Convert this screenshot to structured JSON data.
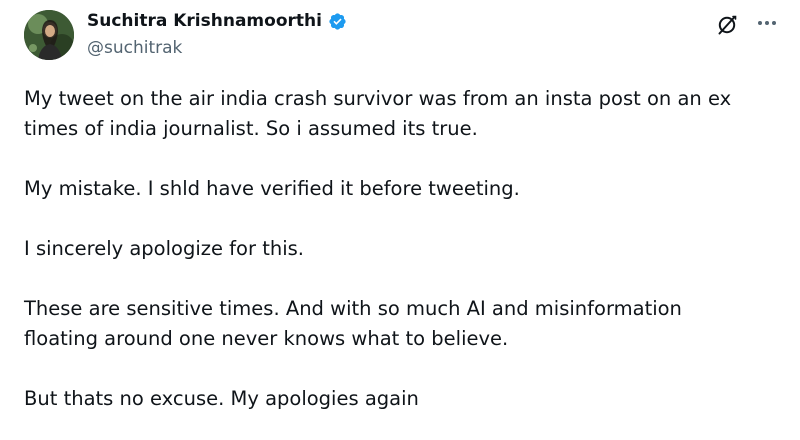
{
  "author": {
    "display_name": "Suchitra Krishnamoorthi",
    "handle": "@suchitrak",
    "verified": true
  },
  "icons": {
    "verified": "verified-badge-icon",
    "grok": "grok-icon",
    "more": "more-icon",
    "avatar": "avatar"
  },
  "colors": {
    "verified_blue": "#1d9bf0",
    "text_primary": "#0f1419",
    "text_secondary": "#536471"
  },
  "tweet": {
    "paragraphs": [
      "My tweet on the air india crash survivor was from an insta post on an ex\ntimes of india journalist. So i assumed its true.",
      "My mistake. I shld have verified it before tweeting.",
      "I sincerely apologize for this.",
      "These are sensitive times. And with so much AI and misinformation\nfloating around one never knows what to believe.",
      "But thats no excuse. My apologies again"
    ]
  }
}
